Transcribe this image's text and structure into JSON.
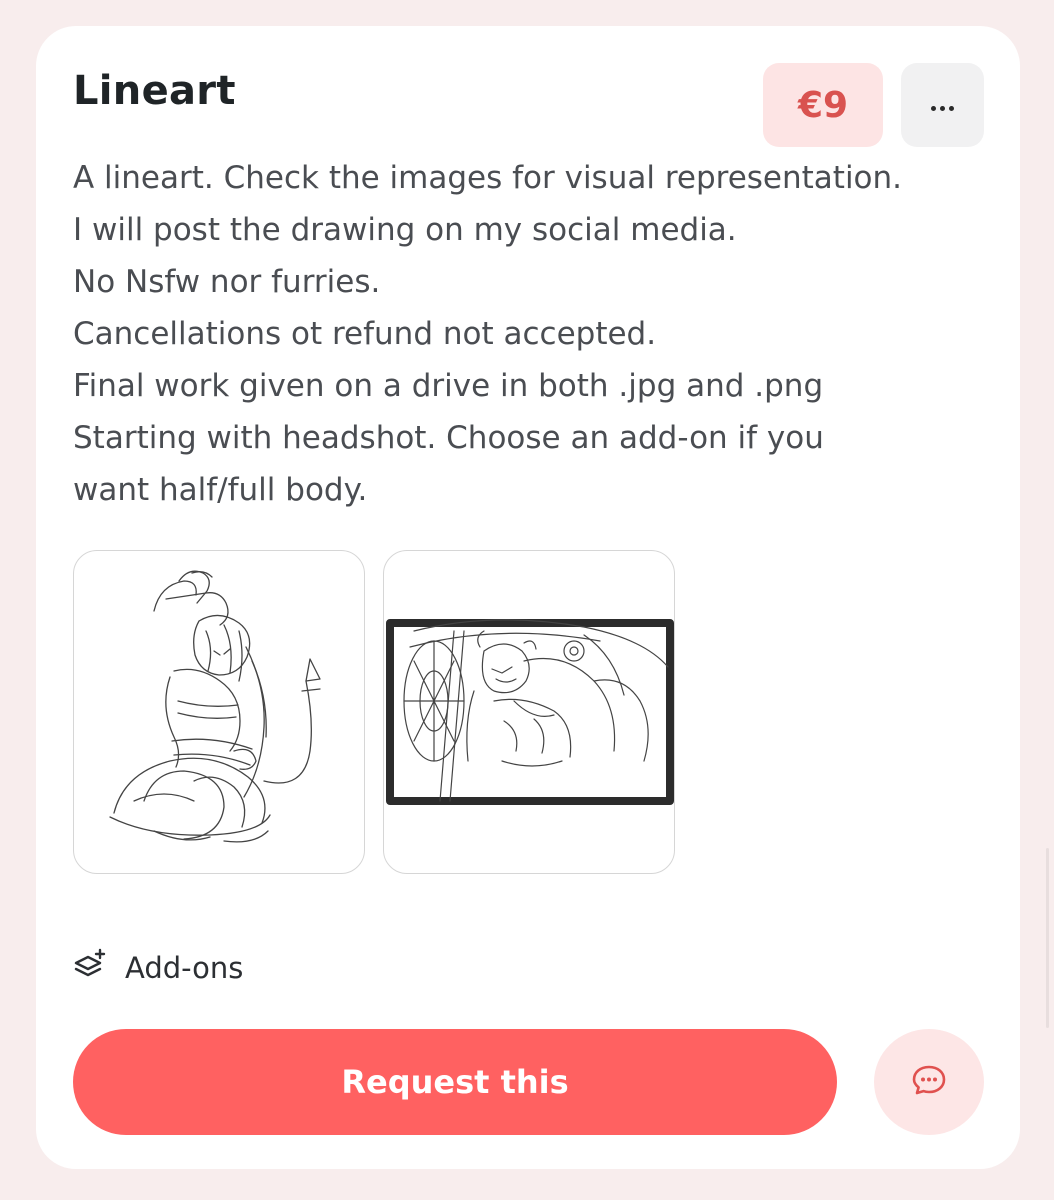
{
  "service": {
    "title": "Lineart",
    "price": "€9",
    "description_lines": [
      "A lineart. Check the images for visual representation.",
      "I will post the drawing on my social media.",
      "No Nsfw nor furries.",
      "Cancellations ot refund not accepted.",
      "Final work given on a drive in both .jpg and .png",
      "Starting with headshot. Choose an add-on if you",
      "want half/full body."
    ]
  },
  "addons": {
    "label": "Add-ons",
    "icon": "layers-plus-icon"
  },
  "actions": {
    "request_label": "Request this",
    "more_icon": "more-dots-icon",
    "chat_icon": "chat-bubble-icon"
  },
  "colors": {
    "accent": "#ff6161",
    "price_bg": "#fde4e4",
    "price_text": "#d9524f",
    "page_bg": "#f8eded"
  }
}
